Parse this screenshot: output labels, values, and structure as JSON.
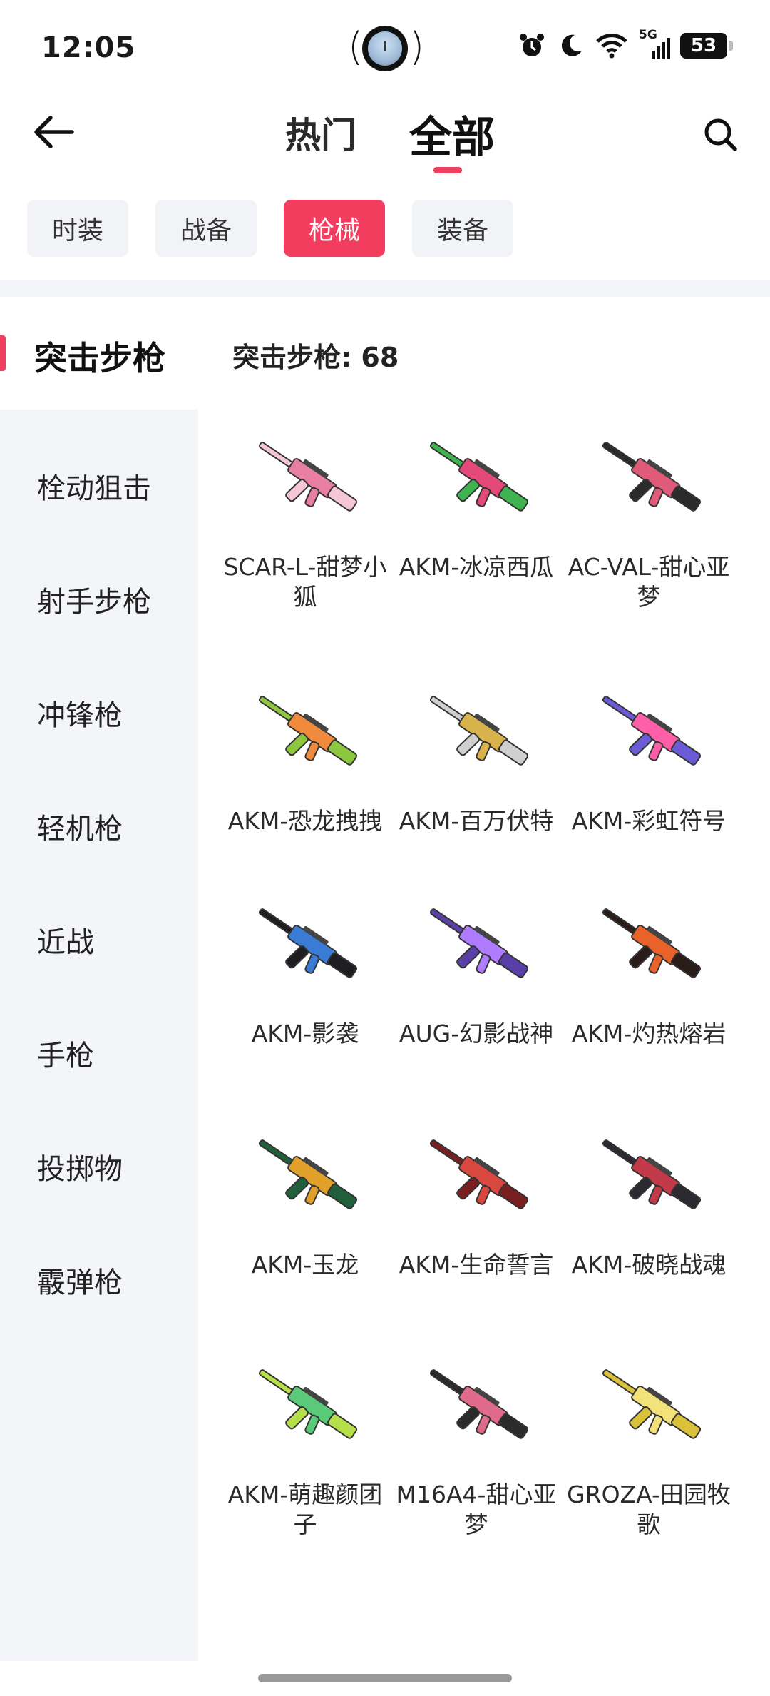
{
  "status": {
    "time": "12:05",
    "network": "5G",
    "battery": "53",
    "icons": [
      "alarm-icon",
      "moon-icon",
      "wifi-icon",
      "signal-icon",
      "battery-icon"
    ]
  },
  "header": {
    "tabs": [
      {
        "label": "热门",
        "active": false
      },
      {
        "label": "全部",
        "active": true
      }
    ],
    "accent": "#ee3f5e"
  },
  "categories": [
    {
      "label": "时装",
      "active": false
    },
    {
      "label": "战备",
      "active": false
    },
    {
      "label": "枪械",
      "active": true
    },
    {
      "label": "装备",
      "active": false
    }
  ],
  "sidebar": {
    "items": [
      {
        "label": "突击步枪",
        "active": true
      },
      {
        "label": "栓动狙击",
        "active": false
      },
      {
        "label": "射手步枪",
        "active": false
      },
      {
        "label": "冲锋枪",
        "active": false
      },
      {
        "label": "轻机枪",
        "active": false
      },
      {
        "label": "近战",
        "active": false
      },
      {
        "label": "手枪",
        "active": false
      },
      {
        "label": "投掷物",
        "active": false
      },
      {
        "label": "霰弹枪",
        "active": false
      }
    ]
  },
  "main": {
    "count_label": "突击步枪: 68",
    "items": [
      {
        "name": "SCAR-L-甜梦小狐",
        "colors": [
          "#f4c6d6",
          "#e87fa3"
        ]
      },
      {
        "name": "AKM-冰凉西瓜",
        "colors": [
          "#3fb34f",
          "#e34a7a"
        ]
      },
      {
        "name": "AC-VAL-甜心亚梦",
        "colors": [
          "#2b2b2b",
          "#e05a7a"
        ]
      },
      {
        "name": "AKM-恐龙拽拽",
        "colors": [
          "#8dc63f",
          "#f08a3c"
        ]
      },
      {
        "name": "AKM-百万伏特",
        "colors": [
          "#cfcfcf",
          "#d8b24a"
        ]
      },
      {
        "name": "AKM-彩虹符号",
        "colors": [
          "#6b5bd6",
          "#ff5fa8"
        ]
      },
      {
        "name": "AKM-影袭",
        "colors": [
          "#1d1d22",
          "#3a7bd5"
        ]
      },
      {
        "name": "AUG-幻影战神",
        "colors": [
          "#5a3fa8",
          "#b07cff"
        ]
      },
      {
        "name": "AKM-灼热熔岩",
        "colors": [
          "#2a1d18",
          "#e8622a"
        ]
      },
      {
        "name": "AKM-玉龙",
        "colors": [
          "#1f5f3a",
          "#e0a02a"
        ]
      },
      {
        "name": "AKM-生命誓言",
        "colors": [
          "#7a1f1f",
          "#d9483f"
        ]
      },
      {
        "name": "AKM-破晓战魂",
        "colors": [
          "#2a2a30",
          "#c23a4a"
        ]
      },
      {
        "name": "AKM-萌趣颜团子",
        "colors": [
          "#b5e04a",
          "#5bc97a"
        ]
      },
      {
        "name": "M16A4-甜心亚梦",
        "colors": [
          "#2b2b2b",
          "#e06a8a"
        ]
      },
      {
        "name": "GROZA-田园牧歌",
        "colors": [
          "#d9c23a",
          "#f3e27a"
        ]
      }
    ]
  }
}
